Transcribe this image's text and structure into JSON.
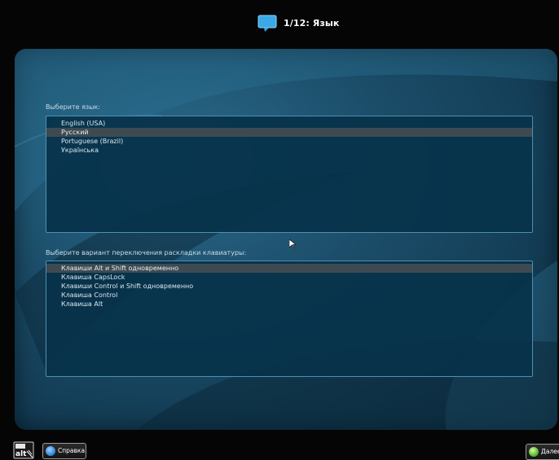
{
  "header": {
    "title": "1/12: Язык",
    "icon": "speech-bubble-icon"
  },
  "language_section": {
    "label": "Выберите язык:",
    "items": [
      {
        "label": "English (USA)",
        "selected": false
      },
      {
        "label": "Русский",
        "selected": true
      },
      {
        "label": "Portuguese (Brazil)",
        "selected": false
      },
      {
        "label": "Українська",
        "selected": false
      }
    ]
  },
  "keyboard_section": {
    "label": "Выберите вариант переключения раскладки клавиатуры:",
    "items": [
      {
        "label": "Клавиши Alt и Shift одновременно",
        "selected": true
      },
      {
        "label": "Клавиша CapsLock",
        "selected": false
      },
      {
        "label": "Клавиши Control и Shift одновременно",
        "selected": false
      },
      {
        "label": "Клавиша Control",
        "selected": false
      },
      {
        "label": "Клавиша Alt",
        "selected": false
      }
    ]
  },
  "footer": {
    "logo_text": "alt",
    "help_label": "Справка",
    "next_label": "Далее"
  },
  "colors": {
    "panel": "#1b4d69",
    "listbox": "#06324a",
    "selection": "#3e4a52",
    "background": "#050505"
  }
}
